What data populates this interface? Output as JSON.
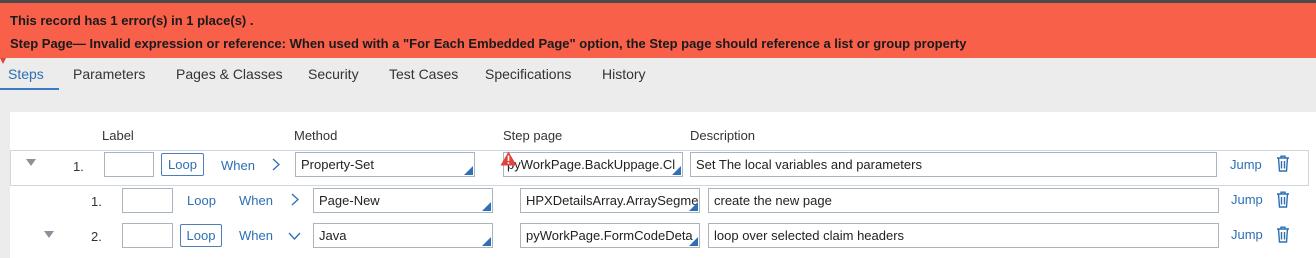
{
  "error": {
    "line1": "This record has 1 error(s) in 1 place(s) .",
    "line2": "Step Page— Invalid expression or reference: When used with a \"For Each Embedded Page\" option, the Step page should reference a list or group property"
  },
  "tabs": [
    "Steps",
    "Parameters",
    "Pages & Classes",
    "Security",
    "Test Cases",
    "Specifications",
    "History"
  ],
  "columns": {
    "label": "Label",
    "method": "Method",
    "step_page": "Step page",
    "description": "Description"
  },
  "steps": [
    {
      "number": "1.",
      "label": "",
      "loop": "Loop",
      "when": "When",
      "method": "Property-Set",
      "step_page": "pyWorkPage.BackUppage.Cl",
      "description": "Set The local variables and parameters",
      "jump": "Jump"
    },
    {
      "number": "1.",
      "label": "",
      "loop": "Loop",
      "when": "When",
      "method": "Page-New",
      "step_page": "HPXDetailsArray.ArraySegme",
      "description": "create the new page",
      "jump": "Jump"
    },
    {
      "number": "2.",
      "label": "",
      "loop": "Loop",
      "when": "When",
      "method": "Java",
      "step_page": "pyWorkPage.FormCodeDeta",
      "description": "loop over selected claim headers",
      "jump": "Jump"
    }
  ],
  "colors": {
    "error_banner": "#f8604a",
    "accent": "#2d6fb5",
    "warning": "#e0443a"
  },
  "icons": [
    "warning-icon",
    "chevron-right-icon",
    "chevron-down-icon",
    "trash-icon",
    "collapse-triangle-icon"
  ]
}
